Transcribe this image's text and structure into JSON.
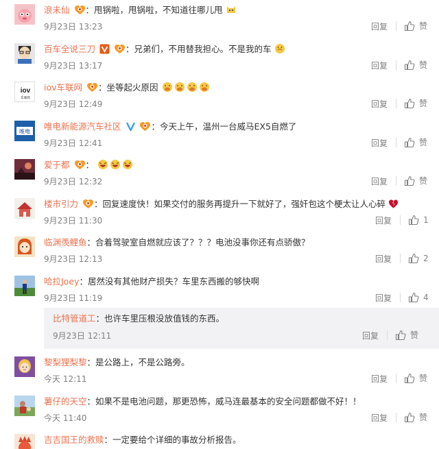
{
  "comments": [
    {
      "user": "浪未仙",
      "content": "甩锅啦，甩锅啦，不知道往哪儿甩",
      "time": "9月23日 13:23",
      "reply_label": "回复",
      "like_label": "赞"
    },
    {
      "user": "百车全说三刀",
      "content": "兄弟们，不用替我担心。不是我的车",
      "time": "9月23日 13:17",
      "reply_label": "回复",
      "like_label": "赞"
    },
    {
      "user": "iov车联网",
      "content": "坐等起火原因",
      "time": "9月23日 12:49",
      "reply_label": "回复",
      "like_label": "赞"
    },
    {
      "user": "唯电新能源汽车社区",
      "content": "今天上午，温州一台威马EX5自燃了",
      "time": "9月23日 12:41",
      "reply_label": "回复",
      "like_label": "赞"
    },
    {
      "user": "爱于都",
      "content": "",
      "time": "9月23日 12:32",
      "reply_label": "回复",
      "like_label": "赞"
    },
    {
      "user": "楼市引力",
      "content": "回复速度快！如果交付的服务再提升一下就好了，强奸包这个梗太让人心碎",
      "time": "9月23日 11:30",
      "reply_label": "回复",
      "like_label": "1"
    },
    {
      "user": "临渊羡鲤鱼",
      "content": "合着驾驶室自燃就应该了？？？电池没事你还有点骄傲？",
      "time": "9月23日 12:13",
      "reply_label": "回复",
      "like_label": "2"
    },
    {
      "user": "哈拉Joey",
      "content": "居然没有其他财产损失？车里东西搬的够快啊",
      "time": "9月23日 11:19",
      "reply_label": "回复",
      "like_label": "4"
    },
    {
      "user": "黎梨狸梨黎",
      "content": "是公路上，不是公路旁。",
      "time": "今天 12:11",
      "reply_label": "回复",
      "like_label": "赞"
    },
    {
      "user": "薯仔的天空",
      "content": "如果不是电池问题，那更恐怖，威马连最基本的安全问题都做不好！！",
      "time": "今天 11:40",
      "reply_label": "回复",
      "like_label": "赞"
    },
    {
      "user": "吉吉国王的救赎",
      "content": "一定要给个详细的事故分析报告。",
      "time": "",
      "reply_label": "",
      "like_label": ""
    }
  ],
  "sub_reply": {
    "user": "比特管道工",
    "content": "也许车里压根没放值钱的东西。",
    "time": "9月23日 12:11",
    "reply_label": "回复",
    "like_label": "赞"
  },
  "avatars": {
    "iov_text": "iov",
    "iov_sub": "车联网",
    "weidian_text": "唯电"
  },
  "colors": {
    "username": "#eb7350",
    "text": "#333333",
    "meta": "#808080",
    "sub_reply_bg": "#f2f2f5"
  },
  "icons": [
    "thumbs-up-icon",
    "vip-badge-icon",
    "verified-badge-icon",
    "emoji-icon"
  ]
}
